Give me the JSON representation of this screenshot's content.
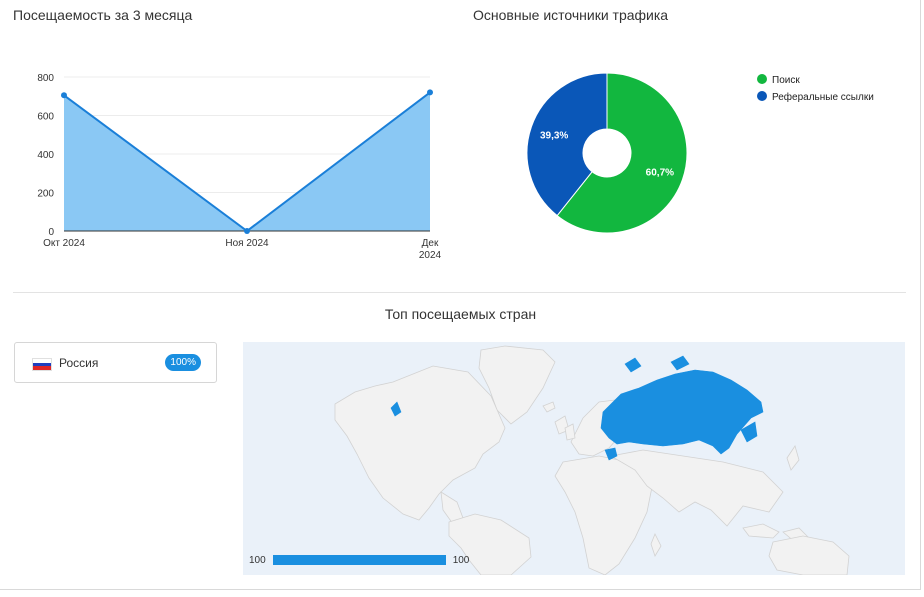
{
  "visits": {
    "title": "Посещаемость за 3 месяца",
    "chart_data": {
      "type": "area",
      "categories": [
        "Окт 2024",
        "Ноя 2024",
        "Дек 2024"
      ],
      "series": [
        {
          "values": [
            705,
            0,
            720
          ]
        }
      ],
      "yticks": [
        "0",
        "200",
        "400",
        "600",
        "800"
      ],
      "ylim": [
        0,
        800
      ],
      "xlabel": "",
      "ylabel": "",
      "grid": true,
      "colors": {
        "line": "#1a7fd8",
        "fill": "#8ac8f4"
      }
    }
  },
  "traffic": {
    "title": "Основные источники трафика",
    "chart_data": {
      "type": "pie",
      "donut": true,
      "slices": [
        {
          "label": "Поиск",
          "value": 60.7,
          "text": "60,7%",
          "color": "#12b73f"
        },
        {
          "label": "Реферальные ссылки",
          "value": 39.3,
          "text": "39,3%",
          "color": "#0a57b8"
        }
      ],
      "legend_position": "right"
    }
  },
  "countries": {
    "title": "Топ посещаемых стран",
    "items": [
      {
        "name": "Россия",
        "badge": "100%",
        "flag_icon": "russia-flag-icon"
      }
    ],
    "map": {
      "highlight_color": "#1a8fe0",
      "base_color": "#f1f1f1",
      "scale_min": "100",
      "scale_max": "100"
    }
  }
}
